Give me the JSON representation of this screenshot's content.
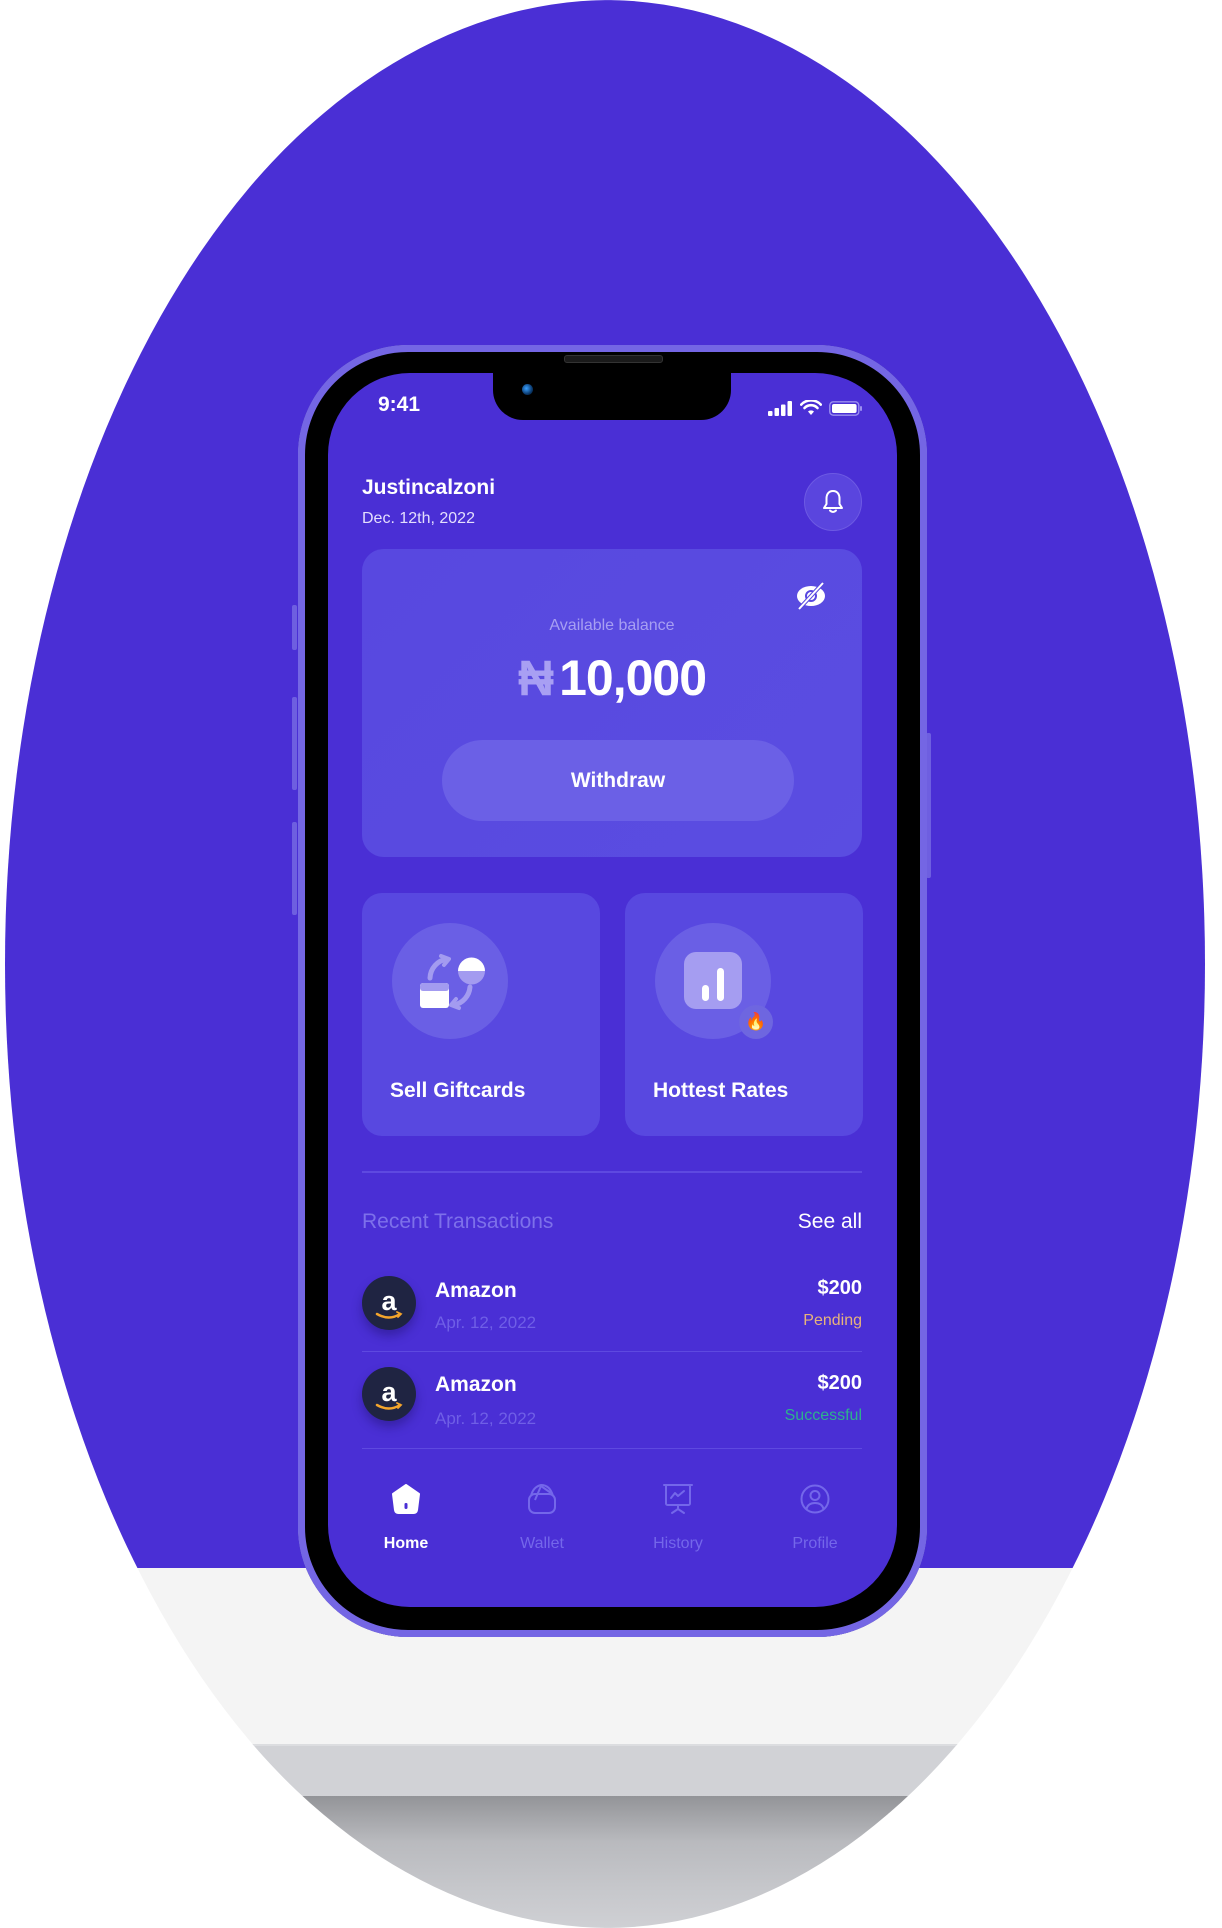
{
  "colors": {
    "brand_purple": "#4a2fd5",
    "card_purple": "#5848e0",
    "pending": "#e7b37b",
    "successful": "#2db28c",
    "muted_text": "#7467ea"
  },
  "status_bar": {
    "time": "9:41",
    "icons": [
      "signal-icon",
      "wifi-icon",
      "battery-icon"
    ]
  },
  "header": {
    "username": "Justincalzoni",
    "date": "Dec. 12th, 2022",
    "notification_icon": "bell-icon"
  },
  "balance_card": {
    "label": "Available balance",
    "currency_symbol": "₦",
    "amount": "10,000",
    "visibility_icon": "eye-slash-icon",
    "withdraw_label": "Withdraw"
  },
  "quick_actions": [
    {
      "label": "Sell Giftcards",
      "icon": "giftcard-exchange-icon"
    },
    {
      "label": "Hottest Rates",
      "icon": "bar-chart-icon",
      "badge": "🔥"
    }
  ],
  "transactions": {
    "title": "Recent Transactions",
    "see_all_label": "See all",
    "items": [
      {
        "merchant": "Amazon",
        "logo": "a",
        "date": "Apr. 12, 2022",
        "amount": "$200",
        "status": "Pending"
      },
      {
        "merchant": "Amazon",
        "logo": "a",
        "date": "Apr. 12, 2022",
        "amount": "$200",
        "status": "Successful"
      }
    ]
  },
  "bottom_nav": {
    "active": "Home",
    "items": [
      {
        "label": "Home",
        "icon": "home-icon"
      },
      {
        "label": "Wallet",
        "icon": "wallet-icon"
      },
      {
        "label": "History",
        "icon": "history-chart-icon"
      },
      {
        "label": "Profile",
        "icon": "profile-icon"
      }
    ]
  }
}
